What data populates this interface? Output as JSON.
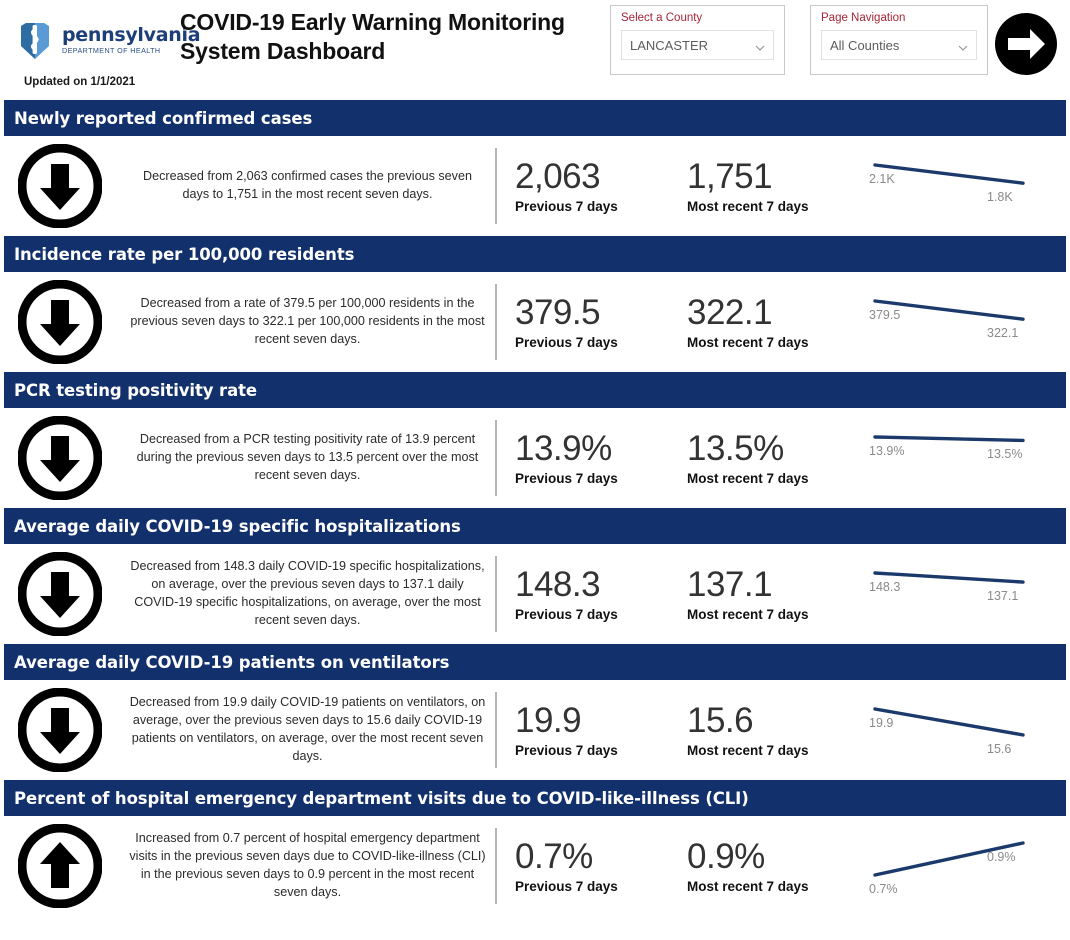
{
  "header": {
    "logo_name": "pennsylvania",
    "logo_sub": "DEPARTMENT OF HEALTH",
    "logo_icon": "pa-keystone-caduceus-logo",
    "updated": "Updated on 1/1/2021",
    "title": "COVID-19 Early Warning Monitoring System Dashboard",
    "county_select": {
      "label": "Select a County",
      "value": "LANCASTER",
      "icon": "chevron-down-icon"
    },
    "page_nav_select": {
      "label": "Page Navigation",
      "value": "All Counties",
      "icon": "chevron-down-icon"
    },
    "next_button_icon": "arrow-right-icon",
    "colors": {
      "navy": "#12306b",
      "label_red": "#a32638",
      "spark_line": "#1b3a6b"
    }
  },
  "labels": {
    "previous": "Previous 7 days",
    "recent": "Most recent 7 days"
  },
  "chart_data": {
    "type": "line",
    "title": "COVID-19 Early Warning Monitoring System Dashboard",
    "subtitle": "LANCASTER county, updated 1/1/2021",
    "categories": [
      "Previous 7 days",
      "Most recent 7 days"
    ],
    "series": [
      {
        "name": "Newly reported confirmed cases",
        "values": [
          2063,
          1751
        ],
        "display": [
          "2,063",
          "1,751"
        ],
        "spark_labels": [
          "2.1K",
          "1.8K"
        ],
        "trend": "down"
      },
      {
        "name": "Incidence rate per 100,000 residents",
        "values": [
          379.5,
          322.1
        ],
        "display": [
          "379.5",
          "322.1"
        ],
        "spark_labels": [
          "379.5",
          "322.1"
        ],
        "trend": "down"
      },
      {
        "name": "PCR testing positivity rate",
        "values": [
          13.9,
          13.5
        ],
        "display": [
          "13.9%",
          "13.5%"
        ],
        "spark_labels": [
          "13.9%",
          "13.5%"
        ],
        "trend": "down"
      },
      {
        "name": "Average daily COVID-19 specific hospitalizations",
        "values": [
          148.3,
          137.1
        ],
        "display": [
          "148.3",
          "137.1"
        ],
        "spark_labels": [
          "148.3",
          "137.1"
        ],
        "trend": "down"
      },
      {
        "name": "Average daily COVID-19 patients on ventilators",
        "values": [
          19.9,
          15.6
        ],
        "display": [
          "19.9",
          "15.6"
        ],
        "spark_labels": [
          "19.9",
          "15.6"
        ],
        "trend": "down"
      },
      {
        "name": "Percent of hospital emergency department visits due to COVID-like-illness (CLI)",
        "values": [
          0.7,
          0.9
        ],
        "display": [
          "0.7%",
          "0.9%"
        ],
        "spark_labels": [
          "0.7%",
          "0.9%"
        ],
        "trend": "up"
      }
    ]
  },
  "sections": [
    {
      "title": "Newly reported confirmed cases",
      "arrow_icon": "arrow-down-circle-icon",
      "description": "Decreased from 2,063 confirmed cases the previous seven days to 1,751 in the most recent seven days.",
      "previous_value": "2,063",
      "recent_value": "1,751",
      "spark_left": "2.1K",
      "spark_right": "1.8K"
    },
    {
      "title": "Incidence rate per 100,000 residents",
      "arrow_icon": "arrow-down-circle-icon",
      "description": "Decreased from a rate of 379.5 per 100,000 residents in the previous seven days to 322.1 per 100,000 residents in the most recent seven days.",
      "previous_value": "379.5",
      "recent_value": "322.1",
      "spark_left": "379.5",
      "spark_right": "322.1"
    },
    {
      "title": "PCR testing positivity rate",
      "arrow_icon": "arrow-down-circle-icon",
      "description": "Decreased from a PCR testing positivity rate of 13.9 percent during the previous seven days to 13.5 percent over the most recent seven days.",
      "previous_value": "13.9%",
      "recent_value": "13.5%",
      "spark_left": "13.9%",
      "spark_right": "13.5%"
    },
    {
      "title": "Average daily COVID-19 specific hospitalizations",
      "arrow_icon": "arrow-down-circle-icon",
      "description": "Decreased from 148.3 daily COVID-19 specific hospitalizations, on average, over the previous seven days to 137.1 daily COVID-19 specific hospitalizations, on average, over the most recent seven days.",
      "previous_value": "148.3",
      "recent_value": "137.1",
      "spark_left": "148.3",
      "spark_right": "137.1"
    },
    {
      "title": "Average daily COVID-19 patients on ventilators",
      "arrow_icon": "arrow-down-circle-icon",
      "description": "Decreased from 19.9 daily COVID-19 patients on ventilators, on average, over the previous seven days to 15.6 daily COVID-19 patients on ventilators, on average, over the most recent seven days.",
      "previous_value": "19.9",
      "recent_value": "15.6",
      "spark_left": "19.9",
      "spark_right": "15.6"
    },
    {
      "title": "Percent of hospital emergency department visits due to COVID-like-illness (CLI)",
      "arrow_icon": "arrow-up-circle-icon",
      "description": "Increased from 0.7 percent of hospital emergency department visits in the previous seven days due to COVID-like-illness (CLI) in the previous seven days to 0.9 percent in the most recent seven days.",
      "previous_value": "0.7%",
      "recent_value": "0.9%",
      "spark_left": "0.7%",
      "spark_right": "0.9%"
    }
  ]
}
